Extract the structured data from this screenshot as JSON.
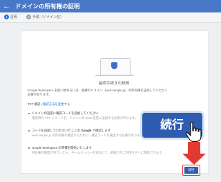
{
  "appbar": {
    "back_icon": "arrow-left-icon",
    "title": "ドメインの所有権の証明"
  },
  "stepper": {
    "steps": [
      {
        "number": "1",
        "label": "証明"
      },
      {
        "number": "2",
        "label": "手順（ドメイン名）"
      }
    ]
  },
  "main": {
    "heading": "最終手続きの説明",
    "intro_1": "Google Workspace を使い始めるには、組織のドメイン（web-sample.jp）の所有権を証明していただく",
    "intro_2": "必要があります。",
    "method_prefix": "TXT 確認",
    "method_link": "確認方法を変更する",
    "bullets": [
      {
        "title": "ドメインの設定に確認コードを追加してください",
        "desc_1": "確認用の TXT レコードを、ドメインの DNS 設定に追加する必要があります。"
      },
      {
        "title_pre": "コードを追加していただいたことを ",
        "title_bold": "Google",
        "title_post": " で確認します",
        "desc_1": "web-sample.jp の所有権を確認するために、確認コードを検出する必要があります。"
      },
      {
        "title": "Google Workspace の準備を開始いたします",
        "desc_1": "所有権の確認が完了したら、チームメンバーを追加して、組織でのご利用をすぐに開始できます。"
      }
    ]
  },
  "callout": {
    "label": "続行",
    "cursor_icon": "hand-pointer-icon"
  },
  "annotation": {
    "arrow": "red-arrow-down-icon",
    "color": "#e23a2f"
  },
  "footer": {
    "continue_label": "続行"
  }
}
